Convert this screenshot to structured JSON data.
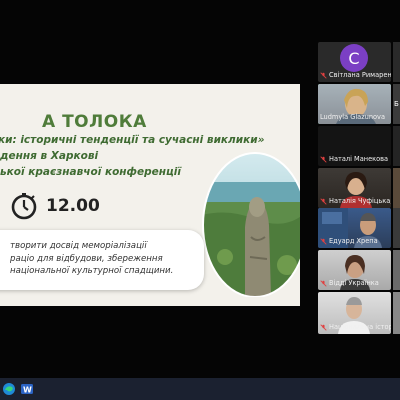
{
  "slide": {
    "title": "А ТОЛОКА",
    "subtitle_1": "ки: історичні тенденції та сучасні виклики»",
    "subtitle_2": "дення в Харкові",
    "subtitle_3": "ької краєзнавчої конференції",
    "time": "12.00",
    "quote_lines": [
      "творити досвід меморіалізації",
      "раціо для відбудови, збереження",
      "національної культурної спадщини."
    ]
  },
  "participants": [
    {
      "id": "p1",
      "name": "Світлана Римаренко",
      "avatar_letter": "С",
      "avatar_color": "#7b3fc4",
      "muted": true
    },
    {
      "id": "p2",
      "name": "Ludmyla Glazunova",
      "muted": false,
      "active": true
    },
    {
      "id": "p3",
      "name": "Наталі Манекова",
      "muted": true
    },
    {
      "id": "p4",
      "name": "Наталія Чуфіцька, Ка...",
      "muted": true
    },
    {
      "id": "p5",
      "name": "Едуард Хрепа",
      "muted": true
    },
    {
      "id": "p6",
      "name": "Відді Українка",
      "muted": true
    },
    {
      "id": "p7",
      "name": "Національна історичн...",
      "muted": true
    }
  ],
  "edge_labels": [
    "Б"
  ],
  "colors": {
    "accent_green": "#4f7c3a",
    "active_border": "#6ed59b",
    "avatar_purple": "#7b3fc4",
    "taskbar": "#1b2130"
  },
  "taskbar_icons": [
    "edge-browser-icon",
    "word-icon"
  ]
}
